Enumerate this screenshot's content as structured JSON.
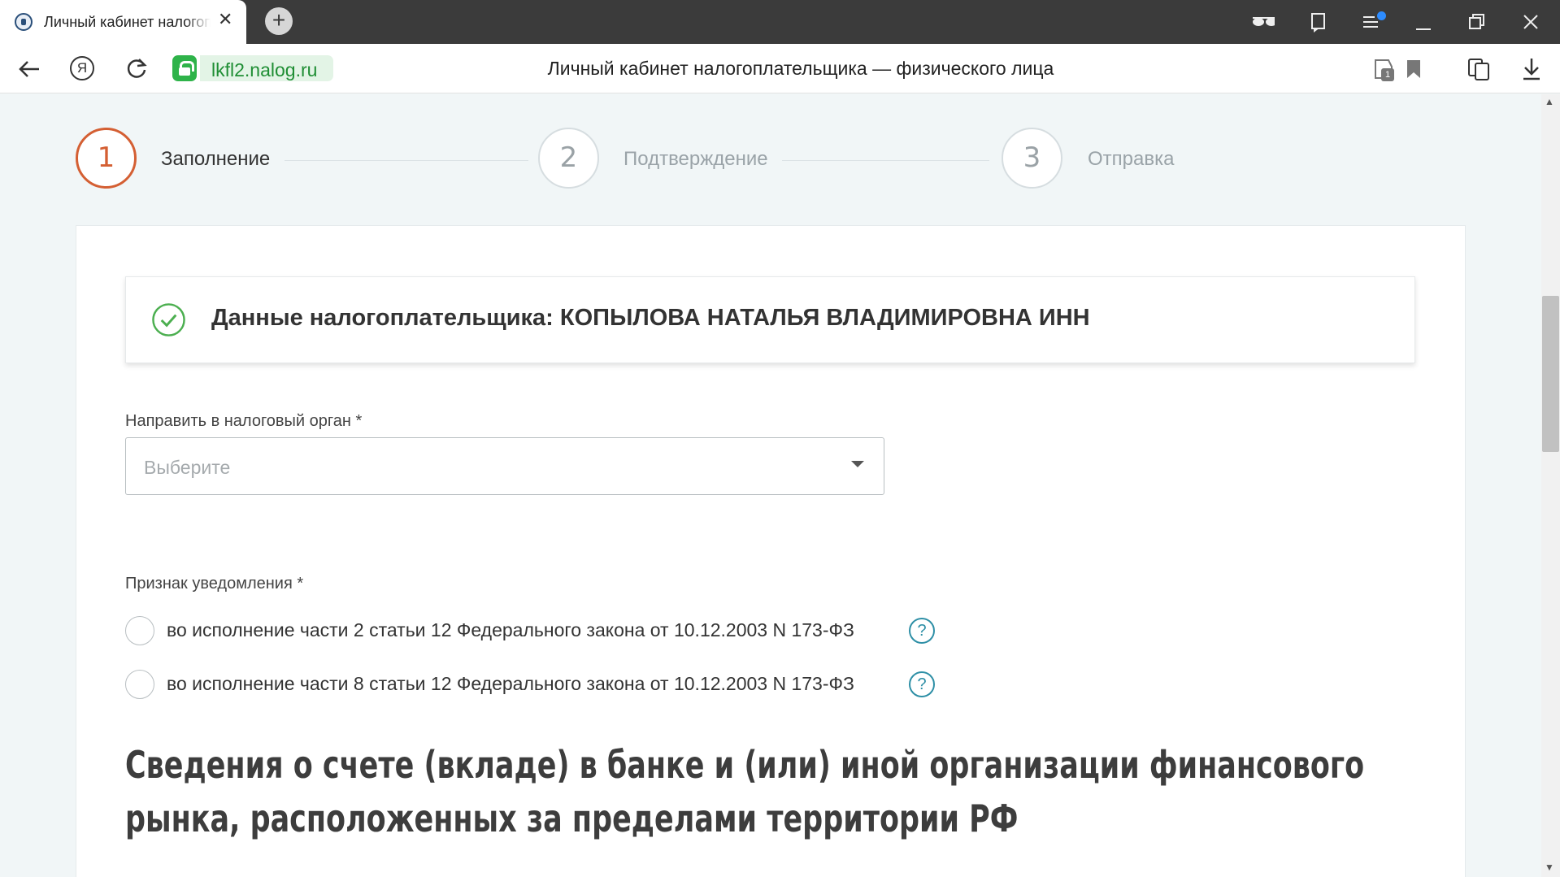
{
  "browser": {
    "tab_title": "Личный кабинет налогоплательщика",
    "tab_close": "✕",
    "new_tab": "+",
    "url": "lkfl2.nalog.ru",
    "page_title": "Личный кабинет налогоплательщика — физического лица",
    "ya_letter": "Я",
    "shield_count": "1",
    "icons": {
      "back": "back-arrow-icon",
      "yandex": "yandex-icon",
      "reload": "reload-icon",
      "lock": "lock-icon",
      "reader": "reader-mode-icon",
      "collections": "collections-icon",
      "menu": "menu-icon",
      "minimize": "minimize-icon",
      "restore": "restore-icon",
      "close": "close-icon",
      "protect": "protect-icon",
      "bookmark": "bookmark-icon",
      "translate": "translate-icon",
      "download": "download-icon"
    }
  },
  "stepper": {
    "steps": [
      {
        "number": "1",
        "label": "Заполнение",
        "active": true
      },
      {
        "number": "2",
        "label": "Подтверждение",
        "active": false
      },
      {
        "number": "3",
        "label": "Отправка",
        "active": false
      }
    ]
  },
  "taxpayer": {
    "text": "Данные налогоплательщика: КОПЫЛОВА НАТАЛЬЯ ВЛАДИМИРОВНА ИНН",
    "status_icon": "check-circle-icon"
  },
  "tax_authority": {
    "label": "Направить в налоговый орган *",
    "placeholder": "Выберите"
  },
  "notification": {
    "label": "Признак уведомления *",
    "options": [
      {
        "label": "во исполнение части 2 статьи 12 Федерального закона от 10.12.2003 N 173-ФЗ",
        "selected": false,
        "help": "?"
      },
      {
        "label": "во исполнение части 8 статьи 12 Федерального закона от 10.12.2003 N 173-ФЗ",
        "selected": false,
        "help": "?"
      }
    ]
  },
  "section": {
    "title": "Сведения о счете (вкладе) в банке и (или) иной организации финансового рынка, расположенных за пределами территории РФ"
  },
  "colors": {
    "accent": "#d45f33",
    "success": "#4caf50",
    "link": "#2e8fa6",
    "page_bg": "#f1f6f7",
    "url_green": "#1f8e34"
  }
}
